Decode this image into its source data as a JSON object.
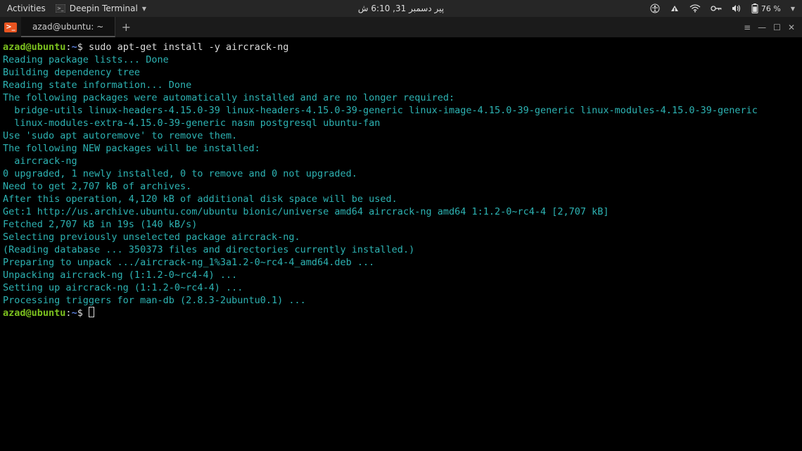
{
  "topbar": {
    "activities": "Activities",
    "app_name": "Deepin Terminal",
    "clock": "پیر دسمبر 31, 6:10 ش",
    "battery": "76 %"
  },
  "window": {
    "tab_title": "azad@ubuntu: ~"
  },
  "prompt": {
    "user": "azad",
    "at": "@",
    "host": "ubuntu",
    "colon": ":",
    "path": "~",
    "dollar": "$ "
  },
  "command": "sudo apt-get install -y aircrack-ng",
  "output": [
    "Reading package lists... Done",
    "Building dependency tree",
    "Reading state information... Done",
    "The following packages were automatically installed and are no longer required:",
    "  bridge-utils linux-headers-4.15.0-39 linux-headers-4.15.0-39-generic linux-image-4.15.0-39-generic linux-modules-4.15.0-39-generic",
    "  linux-modules-extra-4.15.0-39-generic nasm postgresql ubuntu-fan",
    "Use 'sudo apt autoremove' to remove them.",
    "The following NEW packages will be installed:",
    "  aircrack-ng",
    "0 upgraded, 1 newly installed, 0 to remove and 0 not upgraded.",
    "Need to get 2,707 kB of archives.",
    "After this operation, 4,120 kB of additional disk space will be used.",
    "Get:1 http://us.archive.ubuntu.com/ubuntu bionic/universe amd64 aircrack-ng amd64 1:1.2-0~rc4-4 [2,707 kB]",
    "Fetched 2,707 kB in 19s (140 kB/s)",
    "Selecting previously unselected package aircrack-ng.",
    "(Reading database ... 350373 files and directories currently installed.)",
    "Preparing to unpack .../aircrack-ng_1%3a1.2-0~rc4-4_amd64.deb ...",
    "Unpacking aircrack-ng (1:1.2-0~rc4-4) ...",
    "Setting up aircrack-ng (1:1.2-0~rc4-4) ...",
    "Processing triggers for man-db (2.8.3-2ubuntu0.1) ..."
  ]
}
